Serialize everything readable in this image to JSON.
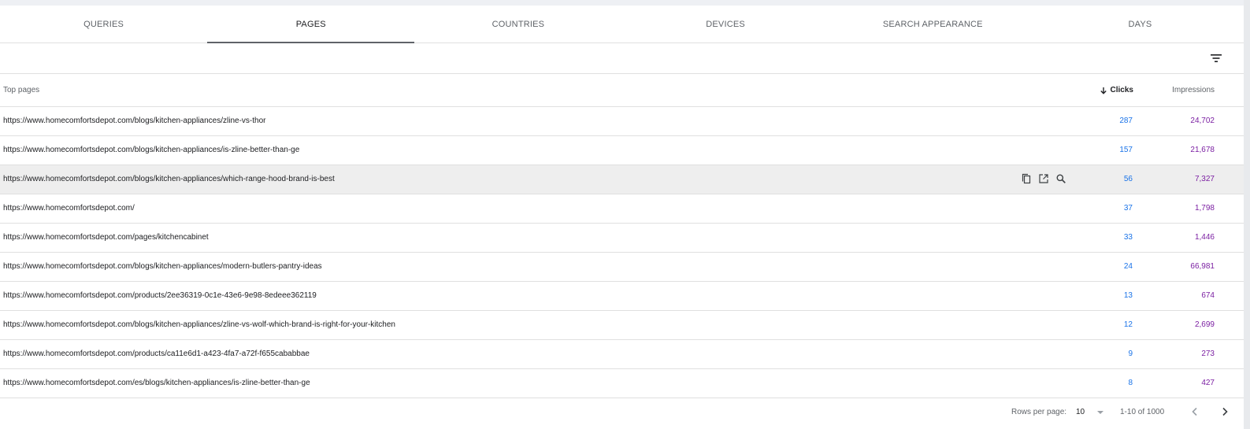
{
  "tabs": [
    {
      "label": "QUERIES"
    },
    {
      "label": "PAGES"
    },
    {
      "label": "COUNTRIES"
    },
    {
      "label": "DEVICES"
    },
    {
      "label": "SEARCH APPEARANCE"
    },
    {
      "label": "DAYS"
    }
  ],
  "active_tab": "PAGES",
  "table": {
    "col_pages": "Top pages",
    "col_clicks": "Clicks",
    "col_impressions": "Impressions",
    "rows": [
      {
        "url": "https://www.homecomfortsdepot.com/blogs/kitchen-appliances/zline-vs-thor",
        "clicks": "287",
        "impressions": "24,702"
      },
      {
        "url": "https://www.homecomfortsdepot.com/blogs/kitchen-appliances/is-zline-better-than-ge",
        "clicks": "157",
        "impressions": "21,678"
      },
      {
        "url": "https://www.homecomfortsdepot.com/blogs/kitchen-appliances/which-range-hood-brand-is-best",
        "clicks": "56",
        "impressions": "7,327"
      },
      {
        "url": "https://www.homecomfortsdepot.com/",
        "clicks": "37",
        "impressions": "1,798"
      },
      {
        "url": "https://www.homecomfortsdepot.com/pages/kitchencabinet",
        "clicks": "33",
        "impressions": "1,446"
      },
      {
        "url": "https://www.homecomfortsdepot.com/blogs/kitchen-appliances/modern-butlers-pantry-ideas",
        "clicks": "24",
        "impressions": "66,981"
      },
      {
        "url": "https://www.homecomfortsdepot.com/products/2ee36319-0c1e-43e6-9e98-8edeee362119",
        "clicks": "13",
        "impressions": "674"
      },
      {
        "url": "https://www.homecomfortsdepot.com/blogs/kitchen-appliances/zline-vs-wolf-which-brand-is-right-for-your-kitchen",
        "clicks": "12",
        "impressions": "2,699"
      },
      {
        "url": "https://www.homecomfortsdepot.com/products/ca11e6d1-a423-4fa7-a72f-f655cababbae",
        "clicks": "9",
        "impressions": "273"
      },
      {
        "url": "https://www.homecomfortsdepot.com/es/blogs/kitchen-appliances/is-zline-better-than-ge",
        "clicks": "8",
        "impressions": "427"
      }
    ]
  },
  "footer": {
    "rows_per_page_label": "Rows per page:",
    "rows_per_page_value": "10",
    "range": "1-10 of 1000"
  },
  "colors": {
    "clicks": "#1a73e8",
    "impressions": "#7b1fa2"
  }
}
